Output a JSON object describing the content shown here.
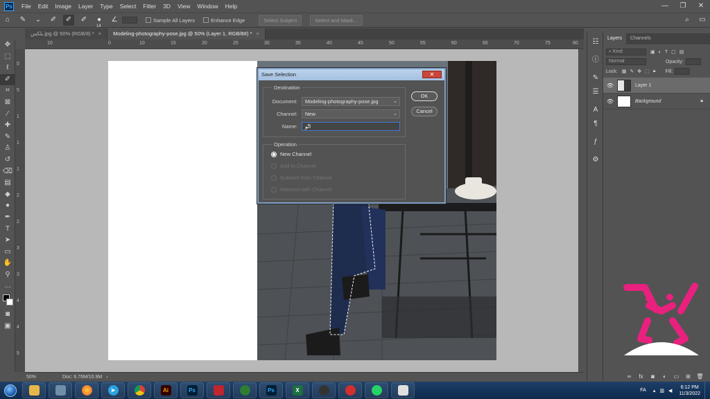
{
  "app": {
    "logo_text": "Ps",
    "menus": [
      "File",
      "Edit",
      "Image",
      "Layer",
      "Type",
      "Select",
      "Filter",
      "3D",
      "View",
      "Window",
      "Help"
    ],
    "window_controls": [
      "—",
      "❐",
      "✕"
    ]
  },
  "options_bar": {
    "brush_size": "14",
    "sample_all_layers": "Sample All Layers",
    "enhance_edge": "Enhance Edge",
    "select_subject": "Select Subject",
    "select_and_mask": "Select and Mask..."
  },
  "tabs": [
    {
      "label": "بلکس.jpg @ 50% (RGB/8) *",
      "close": "×"
    },
    {
      "label": "Modeling-photography-pose.jpg @ 50% (Layer 1, RGB/8#) *",
      "close": "×"
    }
  ],
  "ruler_h": [
    "10",
    "0",
    "10",
    "15",
    "20",
    "25",
    "30",
    "35",
    "40",
    "45",
    "50",
    "55",
    "60",
    "65",
    "70",
    "75",
    "80"
  ],
  "ruler_v": [
    "0",
    "5",
    "1",
    "1",
    "1",
    "2",
    "2",
    "3",
    "3",
    "4",
    "4",
    "5"
  ],
  "status": {
    "zoom": "50%",
    "doc": "Doc: 6.76M/10.9M"
  },
  "dialog": {
    "title": "Save Selection",
    "close": "✕",
    "destination_label": "Destination",
    "document_label": "Document:",
    "document_value": "Modeling-photography-pose.jpg",
    "channel_label": "Channel:",
    "channel_value": "New",
    "name_label": "Name:",
    "name_value": "اتّو",
    "operation_label": "Operation",
    "operations": [
      "New Channel",
      "Add to Channel",
      "Subtract from Channel",
      "Intersect with Channel"
    ],
    "ok": "OK",
    "cancel": "Cancel"
  },
  "layers_panel": {
    "tabs": [
      "Layers",
      "Channels"
    ],
    "kind": "Kind",
    "blend_mode": "Normal",
    "opacity_label": "Opacity:",
    "lock_label": "Lock:",
    "fill_label": "Fill:",
    "layers": [
      {
        "name": "Layer 1",
        "selected": true
      },
      {
        "name": "Background",
        "selected": false
      }
    ]
  },
  "taskbar": {
    "language": "FA",
    "time": "6:12 PM",
    "date": "11/3/2022"
  },
  "colors": {
    "ui_bg": "#535353",
    "canvas_bg": "#b8b8b8",
    "dialog_title": "#a4c0e0",
    "accent": "#31a8ff",
    "watermark": "#e8207e"
  },
  "icons": {
    "toolbar": [
      "move-icon",
      "marquee-icon",
      "lasso-icon",
      "quick-selection-icon",
      "crop-icon",
      "frame-icon",
      "eyedropper-icon",
      "healing-icon",
      "brush-icon",
      "stamp-icon",
      "history-brush-icon",
      "eraser-icon",
      "gradient-icon",
      "blur-icon",
      "dodge-icon",
      "pen-icon",
      "type-icon",
      "path-select-icon",
      "rectangle-icon",
      "hand-icon",
      "zoom-icon"
    ]
  }
}
